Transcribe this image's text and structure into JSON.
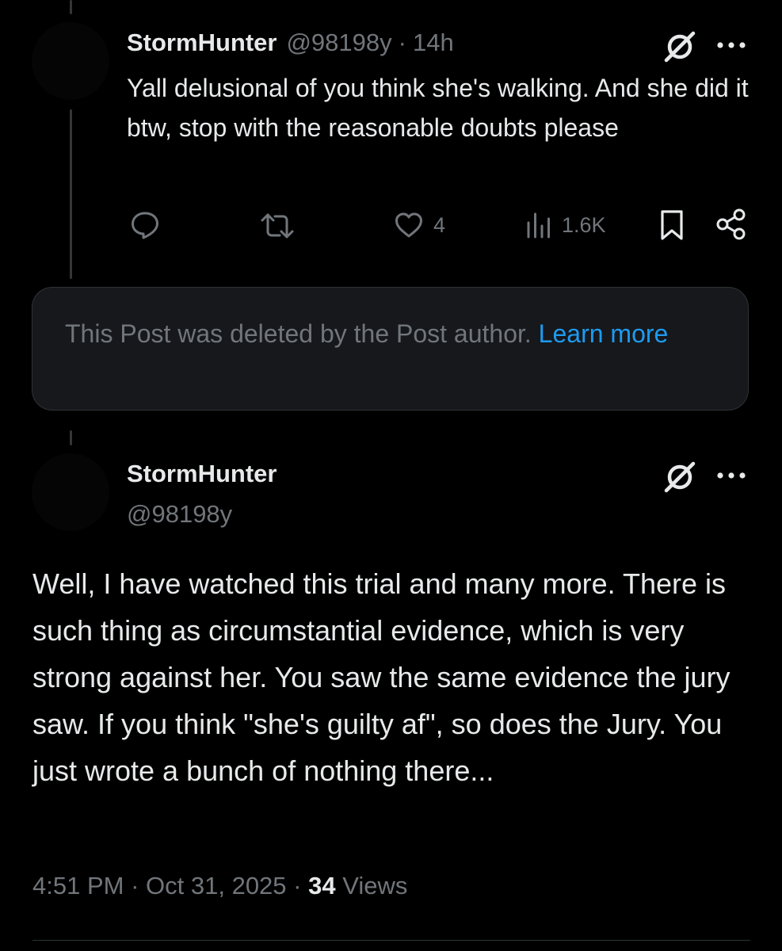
{
  "reply": {
    "display_name": "StormHunter",
    "handle": "@98198y",
    "separator": "·",
    "time": "14h",
    "text": "Yall delusional of you think she's walking. And she did it btw, stop with the reasonable doubts please",
    "actions": {
      "reply_count": "",
      "repost_count": "",
      "like_count": "4",
      "views_count": "1.6K"
    },
    "icons": [
      "grok-icon",
      "more-icon",
      "reply-icon",
      "repost-icon",
      "like-icon",
      "views-icon",
      "bookmark-icon",
      "share-icon"
    ]
  },
  "deleted_notice": {
    "text": "This Post was deleted by the Post author.",
    "link_label": "Learn more"
  },
  "main_post": {
    "display_name": "StormHunter",
    "handle": "@98198y",
    "text": "Well, I have watched this trial and many more. There is such thing as circumstantial evidence, which is very strong against her. You saw the same evidence the jury saw. If you think \"she's guilty af\", so does the Jury. You just wrote a bunch of nothing there...",
    "time": "4:51 PM",
    "date": "Oct 31, 2025",
    "separator": "·",
    "views_count": "34",
    "views_label": "Views"
  },
  "colors": {
    "background": "#000000",
    "text_primary": "#e7e9ea",
    "text_muted": "#71767b",
    "link": "#1d9bf0",
    "card_background": "#16181c",
    "border": "#2f3336"
  }
}
